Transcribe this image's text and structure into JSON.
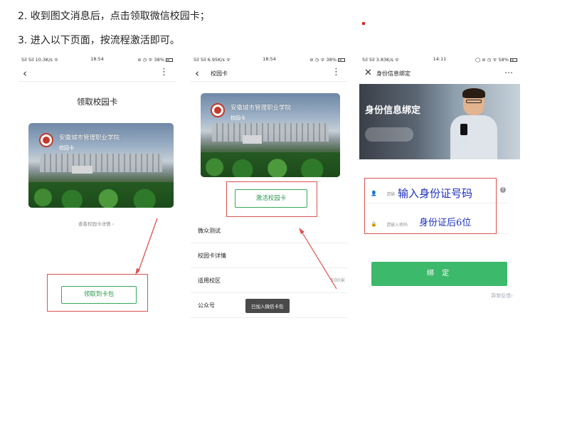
{
  "instructions": {
    "step2": "2. 收到图文消息后，点击领取微信校园卡；",
    "step3": "3. 进入以下页面，按流程激活即可。"
  },
  "colors": {
    "wechat_green": "#3cb96a",
    "annotation_red": "#d9534f",
    "handwriting_blue": "#1a2fbf"
  },
  "phone1": {
    "status": {
      "left": "5il 5il 10.3K/s ᯤ",
      "time": "18:54",
      "right": "⊘ ◷ ᯤ 38%"
    },
    "page_title": "领取校园卡",
    "card": {
      "school": "安徽城市管理职业学院",
      "subtitle": "校园卡"
    },
    "details_link": "查看校园卡详情 ›",
    "receive_button": "领取到卡包"
  },
  "phone2": {
    "status": {
      "left": "5il 5il 6.95K/s ᯤ",
      "time": "18:54",
      "right": "⊘ ◷ ᯤ 38%"
    },
    "nav_title": "校园卡",
    "card": {
      "school": "安徽城市管理职业学院",
      "subtitle": "校园卡"
    },
    "activate_button": "激活校园卡",
    "list": [
      "微众测试",
      "校园卡详情",
      "适用校区",
      "公众号"
    ],
    "distance": "500米",
    "toast": "已加入微信卡包"
  },
  "phone3": {
    "status": {
      "left": "5il 5il 3.83K/s ᯤ",
      "time": "14:11",
      "right": "◯ ⊘ ◷ ᯤ 58%"
    },
    "nav_title": "身份信息绑定",
    "banner_title": "身份信息绑定",
    "field1_placeholder": "请输",
    "field2_placeholder": "请输入密码",
    "handwriting1": "输入身份证号码",
    "handwriting2": "身份证后6位",
    "bind_button": "绑 定",
    "feedback": "异常反馈›"
  },
  "icons": [
    "back-arrow-icon",
    "more-dots-icon",
    "close-icon",
    "user-icon",
    "lock-icon",
    "info-icon",
    "battery-icon",
    "school-logo-icon"
  ]
}
